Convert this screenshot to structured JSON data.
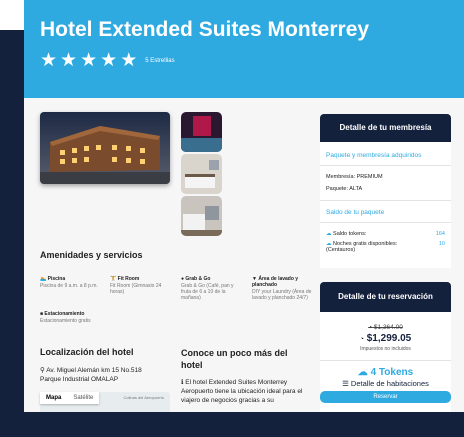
{
  "hotel": {
    "title": "Hotel Extended Suites Monterrey",
    "stars": 5,
    "stars_label": "5 Estrellias"
  },
  "amenities": {
    "title": "Amenidades y servicios",
    "items": [
      {
        "icon": "swimmer-icon",
        "name": "Piscina",
        "desc": "Piscina de 9 a.m. a 8 p.m."
      },
      {
        "icon": "dumbbell-icon",
        "name": "Fit Room",
        "desc": "Fit Room (Gimnasio 24 horas)"
      },
      {
        "icon": "bag-icon",
        "name": "Grab & Go",
        "desc": "Grab & Go (Café, pan y fruta de 6 a 10 de la mañana)"
      },
      {
        "icon": "shirt-icon",
        "name": "Área de lavado y planchado",
        "desc": "DIY your Laundry (Área de lavado y planchado 24/7)"
      },
      {
        "icon": "car-icon",
        "name": "Estacionamiento",
        "desc": "Estacionamiento gratis"
      }
    ]
  },
  "location": {
    "title": "Localización del hotel",
    "address_line1": "Av. Miguel Alemán km 15 No.518",
    "address_line2": "Parque Industrial OMALAP",
    "map_tab_map": "Mapa",
    "map_tab_sat": "Satélite",
    "map_label": "Colinas del Aeropuerto"
  },
  "about": {
    "title": "Conoce un poco más del hotel",
    "text": "El hotel Extended Suites Monterrey Aeropuerto tiene la ubicación ideal para el viajero de negocios gracias a su"
  },
  "membership": {
    "header": "Detalle de tu membresía",
    "acquired_label": "Paquete y membresía adquiridos",
    "membership_line": "Membresía: PREMIUM",
    "package_line": "Paquete: ALTA",
    "balance_label": "Saldo de tu paquete",
    "tokens_label": "Saldo tokens:",
    "tokens_value": "164",
    "nights_label": "Noches gratis disponibles: (Centauros)",
    "nights_value": "10"
  },
  "reservation": {
    "header": "Detalle de tu reservación",
    "old_price": "$1,364.00",
    "new_price": "$1,299.05",
    "tax_note": "Impuestos no incluidos",
    "tokens": "4 Tokens",
    "rooms_label": "Detalle de habitaciones",
    "reserve_button": "Reservar"
  },
  "colors": {
    "accent": "#2eaae1",
    "navy": "#14213d"
  }
}
